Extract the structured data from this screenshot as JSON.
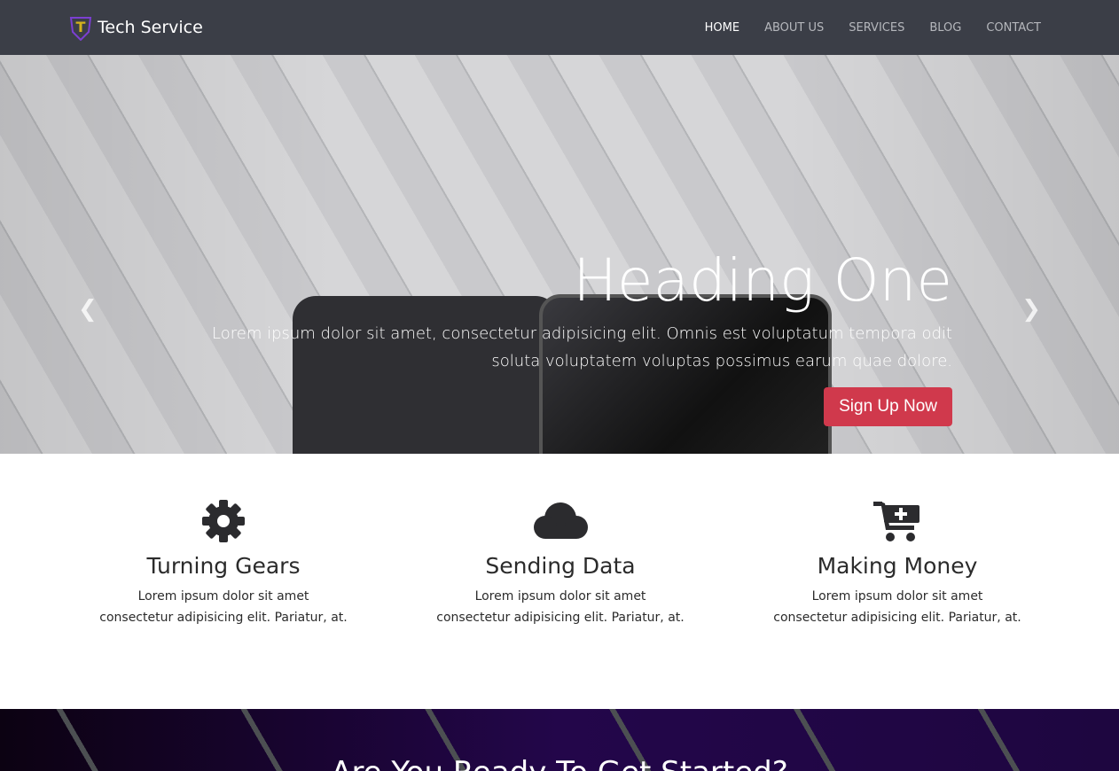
{
  "nav": {
    "brand": "Tech Service",
    "items": [
      "HOME",
      "ABOUT US",
      "SERVICES",
      "BLOG",
      "CONTACT"
    ],
    "active": "HOME"
  },
  "hero": {
    "heading": "Heading One",
    "text": "Lorem ipsum dolor sit amet, consectetur adipisicing elit. Omnis est voluptatum tempora odit soluta voluptatem voluptas possimus earum quae dolore.",
    "cta": "Sign Up Now",
    "slides": 3,
    "active_slide": 1,
    "cta_color": "#d0394c"
  },
  "features": [
    {
      "icon": "gear-icon",
      "title": "Turning Gears",
      "text": "Lorem ipsum dolor sit amet consectetur adipisicing elit. Pariatur, at."
    },
    {
      "icon": "cloud-icon",
      "title": "Sending Data",
      "text": "Lorem ipsum dolor sit amet consectetur adipisicing elit. Pariatur, at."
    },
    {
      "icon": "cart-plus-icon",
      "title": "Making Money",
      "text": "Lorem ipsum dolor sit amet consectetur adipisicing elit. Pariatur, at."
    }
  ],
  "banner": {
    "heading": "Are You Ready To Get Started?"
  }
}
